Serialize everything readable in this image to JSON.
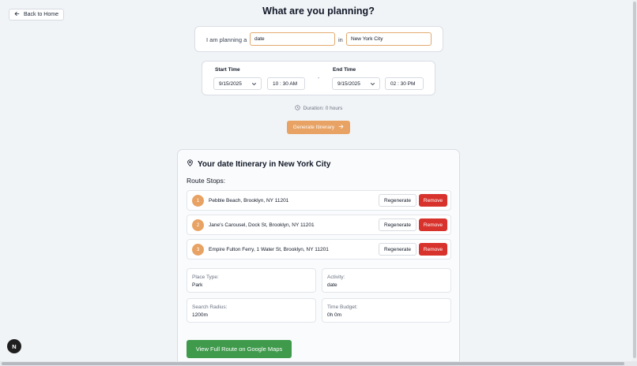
{
  "header": {
    "back_label": "Back to Home",
    "title": "What are you planning?"
  },
  "plan": {
    "prefix": "I am planning a",
    "activity_value": "date",
    "connector": "in",
    "city_value": "New York City"
  },
  "time": {
    "start_label": "Start Time",
    "start_date": "9/15/2025",
    "start_time": "10 : 30  AM",
    "separator": "-",
    "end_label": "End Time",
    "end_date": "9/15/2025",
    "end_time": "02 : 30  PM"
  },
  "duration_text": "Duration: 0 hours",
  "generate_label": "Generate Itinerary",
  "itinerary": {
    "title": "Your date Itinerary in New York City",
    "route_label": "Route Stops:",
    "regenerate_label": "Regenerate",
    "remove_label": "Remove",
    "stops": [
      {
        "num": "1",
        "address": "Pebble Beach, Brooklyn, NY 11201"
      },
      {
        "num": "2",
        "address": "Jane's Carousel, Dock St, Brooklyn, NY 11201"
      },
      {
        "num": "3",
        "address": "Empire Fulton Ferry, 1 Water St, Brooklyn, NY 11201"
      }
    ],
    "info": {
      "place_type_label": "Place Type:",
      "place_type_value": "Park",
      "activity_label": "Activity:",
      "activity_value": "date",
      "radius_label": "Search Radius:",
      "radius_value": "1200m",
      "budget_label": "Time Budget:",
      "budget_value": "0h 0m"
    },
    "maps_label": "View Full Route on Google Maps"
  },
  "dev_badge": "N",
  "colors": {
    "accent": "#e8a263",
    "remove": "#d8322c",
    "maps": "#3f9a4c",
    "background": "#f1f4f7"
  }
}
